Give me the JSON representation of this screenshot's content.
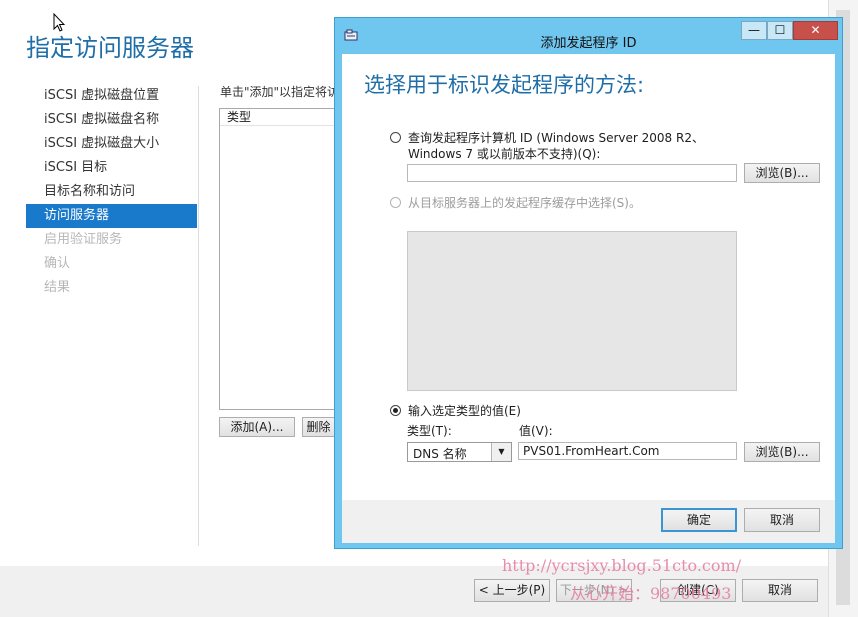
{
  "wizard": {
    "title": "指定访问服务器",
    "nav": [
      {
        "label": "iSCSI 虚拟磁盘位置",
        "state": "normal"
      },
      {
        "label": "iSCSI 虚拟磁盘名称",
        "state": "normal"
      },
      {
        "label": "iSCSI 虚拟磁盘大小",
        "state": "normal"
      },
      {
        "label": "iSCSI 目标",
        "state": "normal"
      },
      {
        "label": "目标名称和访问",
        "state": "normal"
      },
      {
        "label": "访问服务器",
        "state": "selected"
      },
      {
        "label": "启用验证服务",
        "state": "disabled"
      },
      {
        "label": "确认",
        "state": "disabled"
      },
      {
        "label": "结果",
        "state": "disabled"
      }
    ],
    "instruction": "单击\"添加\"以指定将访",
    "list_header": "类型",
    "add_button": "添加(A)...",
    "remove_button": "删除",
    "prev_button": "< 上一步(P)",
    "next_button": "下一步(N) >",
    "create_button": "创建(C)",
    "cancel_button": "取消"
  },
  "dialog": {
    "title": "添加发起程序 ID",
    "minimize_label": "—",
    "maximize_label": "☐",
    "close_label": "✕",
    "heading": "选择用于标识发起程序的方法:",
    "option_query_line1": "查询发起程序计算机 ID (Windows Server 2008 R2、",
    "option_query_line2": "Windows 7 或以前版本不支持)(Q):",
    "option_query_value": "",
    "browse_button_1": "浏览(B)...",
    "option_cache": "从目标服务器上的发起程序缓存中选择(S)。",
    "option_enter": "输入选定类型的值(E)",
    "type_label": "类型(T):",
    "value_label": "值(V):",
    "type_selected": "DNS 名称",
    "value": "PVS01.FromHeart.Com",
    "browse_button_2": "浏览(B)...",
    "ok_button": "确定",
    "cancel_button": "取消"
  },
  "watermark": {
    "line1": "http://ycrsjxy.blog.51cto.com/",
    "line2": "从心开始：98700493"
  },
  "colors": {
    "accent_blue": "#1979ca",
    "dialog_frame": "#6fc6ee",
    "heading_blue": "#1f6ea8",
    "close_red": "#c7504b"
  }
}
